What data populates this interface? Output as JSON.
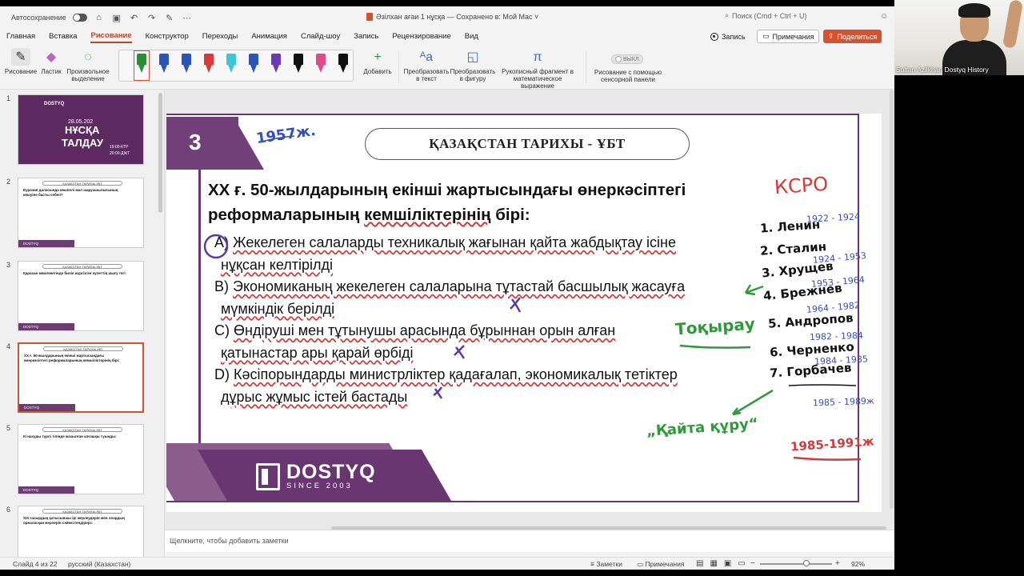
{
  "titlebar": {
    "autosave_label": "Автосохранение",
    "doc_title": "Әзілхан ағаи 1 нұсқа — Сохранено в: Мой Mac ˅",
    "search_placeholder": "Поиск (Cmd + Ctrl + U)"
  },
  "menu": {
    "tabs": [
      "Главная",
      "Вставка",
      "Рисование",
      "Конструктор",
      "Переходы",
      "Анимация",
      "Слайд-шоу",
      "Запись",
      "Рецензирование",
      "Вид"
    ],
    "record_label": "Запись",
    "comments_label": "Примечания",
    "share_label": "Поделиться"
  },
  "ribbon": {
    "draw_label": "Рисование",
    "eraser_label": "Ластик",
    "lasso_label": "Произвольное выделение",
    "add_label": "Добавить",
    "ink_to_text_label": "Преобразовать в текст",
    "ink_to_shape_label": "Преобразовать в фигуру",
    "ink_to_math_label": "Рукописный фрагмент в математическое выражение",
    "touch_toggle_label": "ВЫКЛ.",
    "touch_label": "Рисование с помощью сенсорной панели",
    "pen_colors": [
      "#2e8b3a",
      "#2a55b8",
      "#2a55b8",
      "#d63a3a",
      "#3cc6d6",
      "#2a55b8",
      "#6a3ab8",
      "#111111",
      "#e04a8a",
      "#111111"
    ]
  },
  "thumbnails": [
    {
      "num": "1",
      "title_line1": "НҰСҚА",
      "title_line2": "ТАЛДАУ",
      "brand": "DOSTYQ",
      "date": "28.05.202",
      "time1": "19:00-КТР",
      "time2": "20:00-ДЖТ"
    },
    {
      "num": "2",
      "header": "ҚАЗАҚСТАН ТАРИХЫ-ҰБТ",
      "question": "Еуразия даласында көшпелі мал шаруашылығының көшуіне басты себеп?"
    },
    {
      "num": "3",
      "header": "ҚАЗАҚСТАН ТАРИХЫ-ҰБТ",
      "question": "Қарахан мемлекетінде билік жүргізген әулеттің шығу тегі:"
    },
    {
      "num": "4",
      "header": "ҚАЗАҚСТАН ТАРИХЫ-ҰБТ",
      "question": "XX ғ. 50-жылдарының екінші жартысындағы өнеркәсіптегі реформаларының кемшіліктерінің бірі:"
    },
    {
      "num": "5",
      "header": "ҚАЗАҚСТАН ТАРИХЫ-ҰБТ",
      "question": "Кі нахуды түрлі тілінде жазылған алғашқы туынды:"
    },
    {
      "num": "6",
      "header": "ҚАЗАҚСТАН ТАРИХЫ-ҰБТ",
      "question": "XIX ғасырдың қатысыншы ірі жерлеудерін мен олардың орналасқан жерлерін сәйкестендіріңіз:"
    }
  ],
  "slide": {
    "number": "3",
    "header": "ҚАЗАҚСТАН ТАРИХЫ - ҰБТ",
    "question_line1": "XX ғ. 50-жылдарының екінші жартысындағы өнеркәсіптегі",
    "question_line2_a": "реформаларының ",
    "question_line2_b": "кемшіліктерінің",
    "question_line2_c": " бірі:",
    "answers": [
      {
        "letter": "A)",
        "text": "Жекелеген салаларды техникалық жағынан қайта жабдықтау ісіне",
        "text2": "нұқсан келтірілді"
      },
      {
        "letter": "B)",
        "text": "Экономиканың жекелеген салаларына тұтастай басшылық жасауға",
        "text2": "мүмкіндік берілді"
      },
      {
        "letter": "C)",
        "text": "Өндіруші мен тұтынушы арасында бұрыннан орын алған",
        "text2": "қатынастар ары қарай өрбіді"
      },
      {
        "letter": "D)",
        "text": "Кәсіпорындарды министрліктер қадағалап, экономикалық тетіктер",
        "text2": "дұрыс жұмыс істей бастады"
      }
    ],
    "brand": "DOSTYQ",
    "since": "SINCE 2003"
  },
  "ink": {
    "year": "1957ж.",
    "ussr": "КСРО",
    "leaders": [
      "1. Ленин",
      "2. Сталин",
      "3. Хрущев",
      "4. Брежнев",
      "5. Андропов",
      "6. Черненко",
      "7. Горбачев"
    ],
    "years": [
      "1922 - 1924",
      "1924 - 1953",
      "1953 - 1964",
      "1964 - 1982",
      "1982 - 1984",
      "1984 - 1985",
      "1985 - 1989ж"
    ],
    "red_years": "1985-1991ж",
    "tokyrau": "Тоқырау",
    "kayta_kuru": "„Қайта құру“",
    "cross": "✕"
  },
  "notes": {
    "placeholder": "Щелкните, чтобы добавить заметки"
  },
  "status": {
    "slide_info": "Слайд 4 из 22",
    "language": "русский (Казахстан)",
    "notes_label": "Заметки",
    "comments_label": "Примечания",
    "zoom": "92%"
  },
  "webcam": {
    "name": "Sultan Azilkhan Dostyq History"
  }
}
